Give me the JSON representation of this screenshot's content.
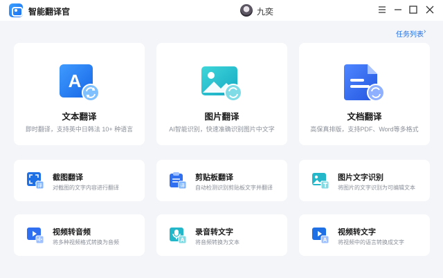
{
  "app": {
    "title": "智能翻译官",
    "user_name": "九奕"
  },
  "header": {
    "task_list_label": "任务列表",
    "task_list_arrow": "›"
  },
  "big_cards": [
    {
      "icon": "text-translate-icon",
      "title": "文本翻译",
      "desc": "即时翻译，支持英中日韩法 10+ 种语言"
    },
    {
      "icon": "image-translate-icon",
      "title": "图片翻译",
      "desc": "AI智能识别，快速准确识别图片中文字"
    },
    {
      "icon": "document-translate-icon",
      "title": "文档翻译",
      "desc": "高保真排版，支持PDF、Word等多格式"
    }
  ],
  "small_cards": [
    {
      "icon": "screenshot-translate-icon",
      "title": "截图翻译",
      "desc": "对截图的文字内容进行翻译"
    },
    {
      "icon": "clipboard-translate-icon",
      "title": "剪贴板翻译",
      "desc": "自动检测识别剪贴板文字并翻译"
    },
    {
      "icon": "image-ocr-icon",
      "title": "图片文字识别",
      "desc": "将图片的文字识别为可编辑文本"
    },
    {
      "icon": "video-to-audio-icon",
      "title": "视频转音频",
      "desc": "将多种视频格式转换为音频"
    },
    {
      "icon": "audio-to-text-icon",
      "title": "录音转文字",
      "desc": "将音频转换为文本"
    },
    {
      "icon": "video-to-text-icon",
      "title": "视频转文字",
      "desc": "将视频中的语言转换成文字"
    }
  ],
  "icon_labels": {
    "translate_badge": "译",
    "text_letter": "A"
  },
  "colors": {
    "accent": "#1f6fe5",
    "card_bg": "#ffffff",
    "page_bg": "#f3f5f9",
    "teal": "#23b7c9"
  }
}
